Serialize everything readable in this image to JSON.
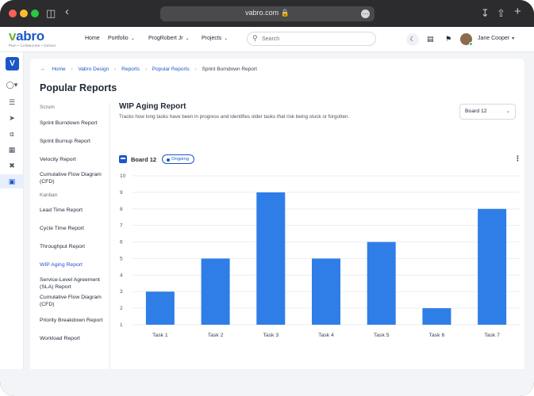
{
  "browser": {
    "url": "vabro.com",
    "colors": {
      "close": "#fe5f57",
      "minimize": "#febc2e",
      "maximize": "#28c840"
    }
  },
  "topbar": {
    "logo_text": "vabro",
    "logo_tagline": "Plan • Collaborate • Deliver",
    "nav": [
      {
        "label": "Home",
        "has_menu": false
      },
      {
        "label": "Portfolio",
        "has_menu": true
      },
      {
        "label": "ProgRobert Jr",
        "has_menu": true
      },
      {
        "label": "Projects",
        "has_menu": true
      }
    ],
    "search_placeholder": "Search",
    "user_name": "Jane Cooper"
  },
  "sidebar": {
    "workspace_letter": "V",
    "icons": [
      "reports-icon",
      "send-icon",
      "bell-icon",
      "calendar-icon",
      "tools-icon",
      "dashboard-icon"
    ],
    "active_icon": "dashboard-icon"
  },
  "breadcrumb": {
    "items": [
      "Home",
      "Vabro Design",
      "Reports",
      "Popular Reports"
    ],
    "current": "Sprint Burndown Report"
  },
  "page": {
    "title": "Popular Reports"
  },
  "report_nav": {
    "scrum_label": "Scrum",
    "scrum_items": [
      "Sprint Burndown Report",
      "Sprint Burnup Report",
      "Velocity Report",
      "Cumulative Flow Diagram (CFD)"
    ],
    "kanban_label": "Kanban",
    "kanban_items": [
      "Lead Time Report",
      "Cycle Time Report",
      "Throughput Report",
      "WIP Aging Report",
      "Service-Level Agreement (SLA) Report",
      "Cumulative Flow Diagram (CFD)",
      "Priority Breakdown Report",
      "Workload Report"
    ],
    "active_item": "WIP Aging Report"
  },
  "report": {
    "title": "WIP Aging Report",
    "description": "Tracks how long tasks have been in progress and identifies older tasks that risk being stuck or forgotten.",
    "board_select": "Board 12",
    "board_name": "Board 12",
    "status": "Ongoing"
  },
  "colors": {
    "accent": "#1c57c7",
    "bar": "#2f7de7",
    "logo_v": "#6bb33c"
  },
  "chart_data": {
    "type": "bar",
    "categories": [
      "Task 1",
      "Task 2",
      "Task 3",
      "Task 4",
      "Task 5",
      "Task 6",
      "Task 7"
    ],
    "values": [
      3,
      5,
      9,
      5,
      6,
      2,
      8
    ],
    "ylim": [
      1,
      10
    ],
    "yticks": [
      1,
      2,
      3,
      4,
      5,
      6,
      7,
      8,
      9,
      10
    ],
    "grid": true,
    "title": "",
    "xlabel": "",
    "ylabel": ""
  }
}
